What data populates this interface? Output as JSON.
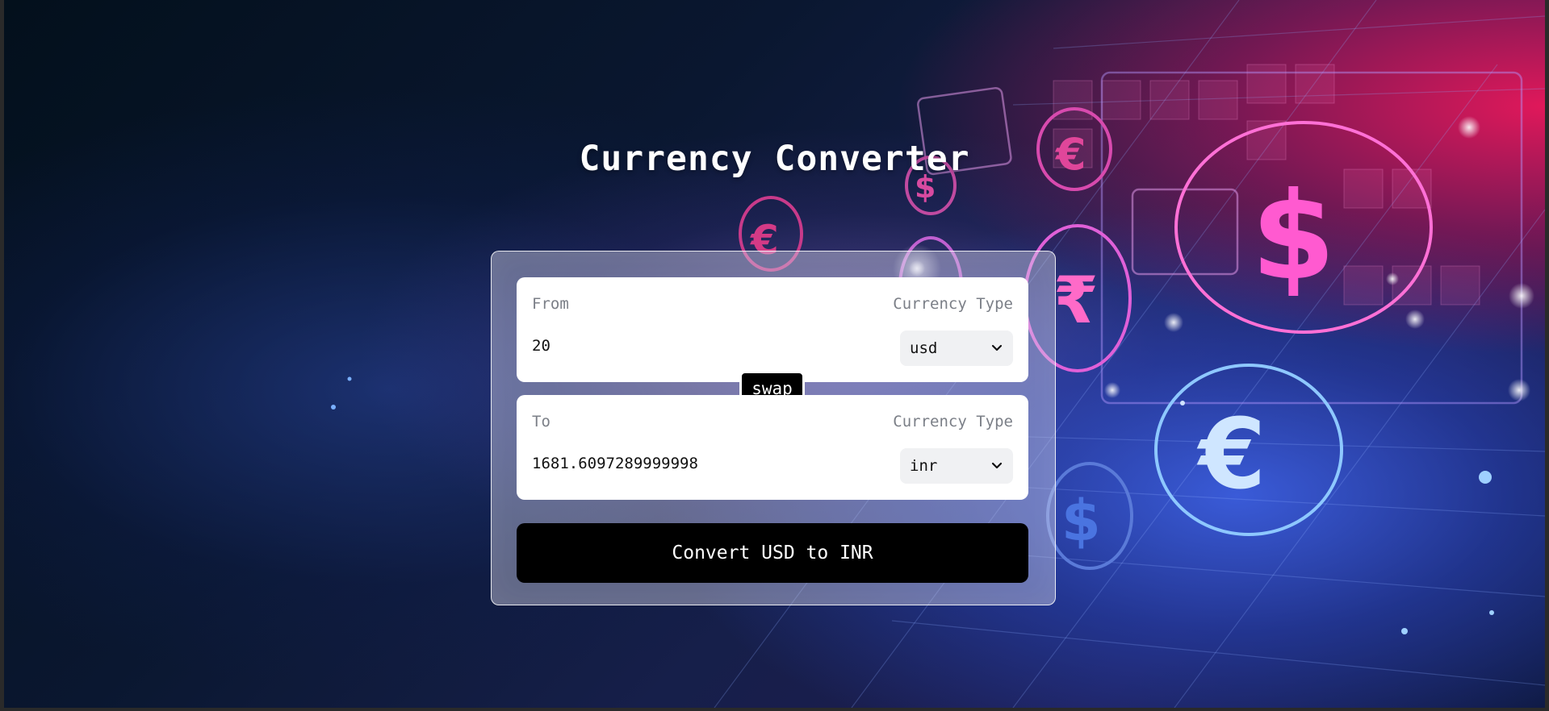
{
  "page": {
    "title": "Currency Converter"
  },
  "converter": {
    "from": {
      "label": "From",
      "currency_type_label": "Currency Type",
      "amount": "20",
      "currency": "usd"
    },
    "swap_label": "swap",
    "to": {
      "label": "To",
      "currency_type_label": "Currency Type",
      "amount": "1681.6097289999998",
      "currency": "inr"
    },
    "convert_label": "Convert USD to INR"
  },
  "icons": {
    "select_chevron": "chevron-down-icon"
  },
  "colors": {
    "panel_button_bg": "#000000",
    "panel_button_text": "#ffffff",
    "field_bg": "#ffffff",
    "select_bg": "#f0f1f3",
    "label_text": "#7b7f87"
  }
}
